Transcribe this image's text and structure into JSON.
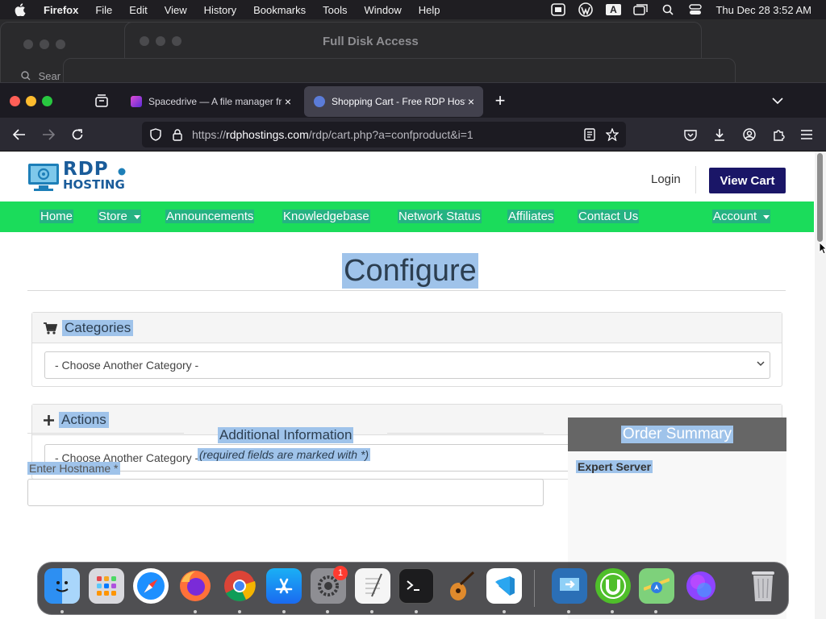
{
  "menubar": {
    "app": "Firefox",
    "items": [
      "File",
      "Edit",
      "View",
      "History",
      "Bookmarks",
      "Tools",
      "Window",
      "Help"
    ],
    "status_icons": [
      "mirror-icon",
      "wordpress-icon",
      "text-input-icon",
      "window-icon",
      "search-icon",
      "control-center-icon"
    ],
    "text_input_label": "A",
    "clock": "Thu Dec 28  3:52 AM"
  },
  "background": {
    "window_title": "Full Disk Access",
    "search_placeholder": "Sear"
  },
  "browser": {
    "tabs": [
      {
        "title": "Spacedrive — A file manager fro",
        "active": false,
        "favicon_color": "#7b3bd0"
      },
      {
        "title": "Shopping Cart - Free RDP Hosti",
        "active": true,
        "favicon_color": "#5b7cd8"
      }
    ],
    "new_tab_label": "+",
    "url_prefix": "https://",
    "url_domain": "rdphostings.com",
    "url_path": "/rdp/cart.php?a=confproduct&i=1"
  },
  "site": {
    "logo_top": "RDP",
    "logo_bottom": "HOSTING",
    "login_label": "Login",
    "view_cart_label": "View Cart",
    "nav": {
      "home": "Home",
      "store": "Store",
      "announcements": "Announcements",
      "knowledgebase": "Knowledgebase",
      "network_status": "Network Status",
      "affiliates": "Affiliates",
      "contact_us": "Contact Us",
      "account": "Account"
    },
    "heading": "Configure",
    "categories": {
      "title": "Categories",
      "select_value": "- Choose Another Category -"
    },
    "actions": {
      "title": "Actions",
      "select_value": "- Choose Another Category -"
    },
    "additional_info": {
      "title": "Additional Information",
      "subtitle": "(required fields are marked with *)",
      "hostname_label": "Enter Hostname *"
    },
    "order_summary": {
      "title": "Order Summary",
      "product": "Expert Server"
    }
  },
  "dock": {
    "apps": [
      "Finder",
      "Launchpad",
      "Safari",
      "Firefox",
      "Chrome",
      "App Store",
      "System Settings",
      "TextEdit",
      "Terminal",
      "GarageBand",
      "VS Code",
      "Remote Desktop",
      "uTorrent",
      "Maps",
      "Siri",
      "Trash"
    ],
    "settings_badge": "1"
  },
  "colors": {
    "nav_green": "#1bdc5b",
    "cart_button": "#1a1667",
    "selection": "#9fc3ea",
    "order_header": "#666666"
  }
}
